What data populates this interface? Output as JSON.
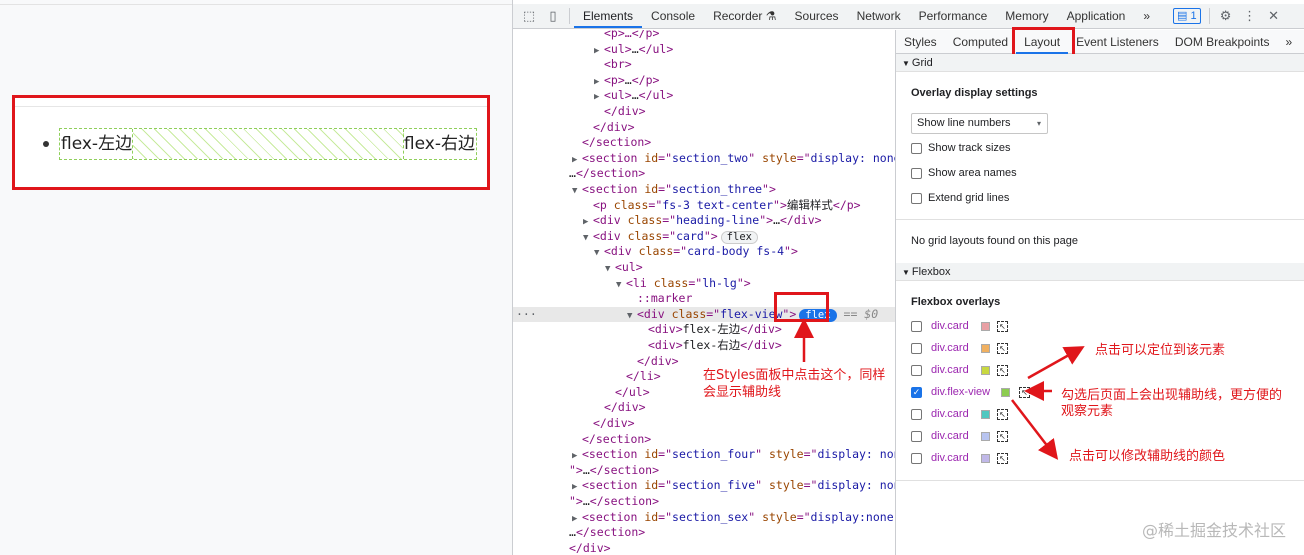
{
  "page_preview": {
    "left_text": "flex-左边",
    "right_text": "flex-右边"
  },
  "devtools": {
    "tabs": [
      "Elements",
      "Console",
      "Recorder",
      "Sources",
      "Network",
      "Performance",
      "Memory",
      "Application"
    ],
    "active_tab": "Elements",
    "more": "»",
    "messages_count": "1",
    "icons": [
      "inspect-icon",
      "device-icon",
      "gear-icon",
      "more-vert-icon"
    ],
    "sidebar_tabs": [
      "Styles",
      "Computed",
      "Layout",
      "Event Listeners",
      "DOM Breakpoints"
    ],
    "sidebar_more": "»",
    "dom_lines": [
      {
        "indent": 3,
        "arrow": "",
        "html": "<span class='tag'>&lt;p&gt;…&lt;/p&gt;</span>"
      },
      {
        "indent": 3,
        "arrow": "▶",
        "html": "<span class='tag'>&lt;ul&gt;</span><span class='tx'>…</span><span class='tag'>&lt;/ul&gt;</span>"
      },
      {
        "indent": 3,
        "arrow": "",
        "html": "<span class='tag'>&lt;br&gt;</span>"
      },
      {
        "indent": 3,
        "arrow": "▶",
        "html": "<span class='tag'>&lt;p&gt;</span><span class='tx'>…</span><span class='tag'>&lt;/p&gt;</span>"
      },
      {
        "indent": 3,
        "arrow": "▶",
        "html": "<span class='tag'>&lt;ul&gt;</span><span class='tx'>…</span><span class='tag'>&lt;/ul&gt;</span>"
      },
      {
        "indent": 3,
        "arrow": "",
        "html": "<span class='tag'>&lt;/div&gt;</span>"
      },
      {
        "indent": 2,
        "arrow": "",
        "html": "<span class='tag'>&lt;/div&gt;</span>"
      },
      {
        "indent": 1,
        "arrow": "",
        "html": "<span class='tag'>&lt;/section&gt;</span>"
      },
      {
        "indent": 1,
        "arrow": "▶",
        "html": "<span class='tag'>&lt;section </span><span class='an'>id</span>=\"<span class='av'>section_two</span>\" <span class='an'>style</span>=\"<span class='av'>display: none;</span>\"&gt;"
      },
      {
        "indent": 0,
        "arrow": "",
        "html": "<span class='tx'>…</span><span class='tag'>&lt;/section&gt;</span>"
      },
      {
        "indent": 1,
        "arrow": "▼",
        "html": "<span class='tag'>&lt;section </span><span class='an'>id</span>=\"<span class='av'>section_three</span>\"&gt;"
      },
      {
        "indent": 2,
        "arrow": "",
        "html": "<span class='tag'>&lt;p </span><span class='an'>class</span>=\"<span class='av'>fs-3 text-center</span>\"&gt;<span class='tx'>编辑样式</span>&lt;/p&gt;"
      },
      {
        "indent": 2,
        "arrow": "▶",
        "html": "<span class='tag'>&lt;div </span><span class='an'>class</span>=\"<span class='av'>heading-line</span>\"&gt;<span class='tx'>…</span>&lt;/div&gt;"
      },
      {
        "indent": 2,
        "arrow": "▼",
        "html": "<span class='tag'>&lt;div </span><span class='an'>class</span>=\"<span class='av'>card</span>\"&gt;<span class='pill'>flex</span>"
      },
      {
        "indent": 3,
        "arrow": "▼",
        "html": "<span class='tag'>&lt;div </span><span class='an'>class</span>=\"<span class='av'>card-body fs-4</span>\"&gt;"
      },
      {
        "indent": 4,
        "arrow": "▼",
        "html": "<span class='tag'>&lt;ul&gt;</span>"
      },
      {
        "indent": 5,
        "arrow": "▼",
        "html": "<span class='tag'>&lt;li </span><span class='an'>class</span>=\"<span class='av'>lh-lg</span>\"&gt;"
      },
      {
        "indent": 6,
        "arrow": "",
        "html": "<span class='tag'>::marker</span>"
      },
      {
        "indent": 6,
        "arrow": "▼",
        "html": "<span class='tag'>&lt;div </span><span class='an'>class</span>=\"<span class='av'>flex-view</span>\"&gt;<span class='pill blue'>flex</span> <span class='dollar'>== $0</span>",
        "selected": true
      },
      {
        "indent": 7,
        "arrow": "",
        "html": "<span class='tag'>&lt;div&gt;</span><span class='tx'>flex-左边</span><span class='tag'>&lt;/div&gt;</span>"
      },
      {
        "indent": 7,
        "arrow": "",
        "html": "<span class='tag'>&lt;div&gt;</span><span class='tx'>flex-右边</span><span class='tag'>&lt;/div&gt;</span>"
      },
      {
        "indent": 6,
        "arrow": "",
        "html": "<span class='tag'>&lt;/div&gt;</span>"
      },
      {
        "indent": 5,
        "arrow": "",
        "html": "<span class='tag'>&lt;/li&gt;</span>"
      },
      {
        "indent": 4,
        "arrow": "",
        "html": "<span class='tag'>&lt;/ul&gt;</span>"
      },
      {
        "indent": 3,
        "arrow": "",
        "html": "<span class='tag'>&lt;/div&gt;</span>"
      },
      {
        "indent": 2,
        "arrow": "",
        "html": "<span class='tag'>&lt;/div&gt;</span>"
      },
      {
        "indent": 1,
        "arrow": "",
        "html": "<span class='tag'>&lt;/section&gt;</span>"
      },
      {
        "indent": 1,
        "arrow": "▶",
        "html": "<span class='tag'>&lt;section </span><span class='an'>id</span>=\"<span class='av'>section_four</span>\" <span class='an'>style</span>=\"<span class='av'>display: none;</span>"
      },
      {
        "indent": 0,
        "arrow": "",
        "html": "\"&gt;<span class='tx'>…</span><span class='tag'>&lt;/section&gt;</span>"
      },
      {
        "indent": 1,
        "arrow": "▶",
        "html": "<span class='tag'>&lt;section </span><span class='an'>id</span>=\"<span class='av'>section_five</span>\" <span class='an'>style</span>=\"<span class='av'>display: none;</span>"
      },
      {
        "indent": 0,
        "arrow": "",
        "html": "\"&gt;<span class='tx'>…</span><span class='tag'>&lt;/section&gt;</span>"
      },
      {
        "indent": 1,
        "arrow": "▶",
        "html": "<span class='tag'>&lt;section </span><span class='an'>id</span>=\"<span class='av'>section_sex</span>\" <span class='an'>style</span>=\"<span class='av'>display:none;</span>\"&gt;"
      },
      {
        "indent": 0,
        "arrow": "",
        "html": "<span class='tx'>…</span><span class='tag'>&lt;/section&gt;</span>"
      },
      {
        "indent": 0,
        "arrow": "",
        "html": "<span class='tag'>&lt;/div&gt;</span>"
      }
    ],
    "ellipsis_marker": "…",
    "layout": {
      "grid_header": "Grid",
      "overlay_title": "Overlay display settings",
      "select_value": "Show line numbers",
      "checkboxes": [
        "Show track sizes",
        "Show area names",
        "Extend grid lines"
      ],
      "no_grid": "No grid layouts found on this page",
      "flexbox_header": "Flexbox",
      "flex_overlays_title": "Flexbox overlays",
      "overlays": [
        {
          "name": "div.card",
          "color": "#e8a0a4",
          "checked": false
        },
        {
          "name": "div.card",
          "color": "#f0b060",
          "checked": false
        },
        {
          "name": "div.card",
          "color": "#c8d840",
          "checked": false
        },
        {
          "name": "div.flex-view",
          "color": "#8ccc50",
          "checked": true
        },
        {
          "name": "div.card",
          "color": "#50c8c0",
          "checked": false
        },
        {
          "name": "div.card",
          "color": "#b8c4f0",
          "checked": false
        },
        {
          "name": "div.card",
          "color": "#c0b8e8",
          "checked": false
        }
      ]
    }
  },
  "annotations": {
    "styles_note_1": "在Styles面板中点击这个，同样",
    "styles_note_2": "会显示辅助线",
    "locate_note": "点击可以定位到该元素",
    "check_note_1": "勾选后页面上会出现辅助线，更方便的",
    "check_note_2": "观察元素",
    "color_note": "点击可以修改辅助线的颜色"
  },
  "watermark": "@稀土掘金技术社区"
}
